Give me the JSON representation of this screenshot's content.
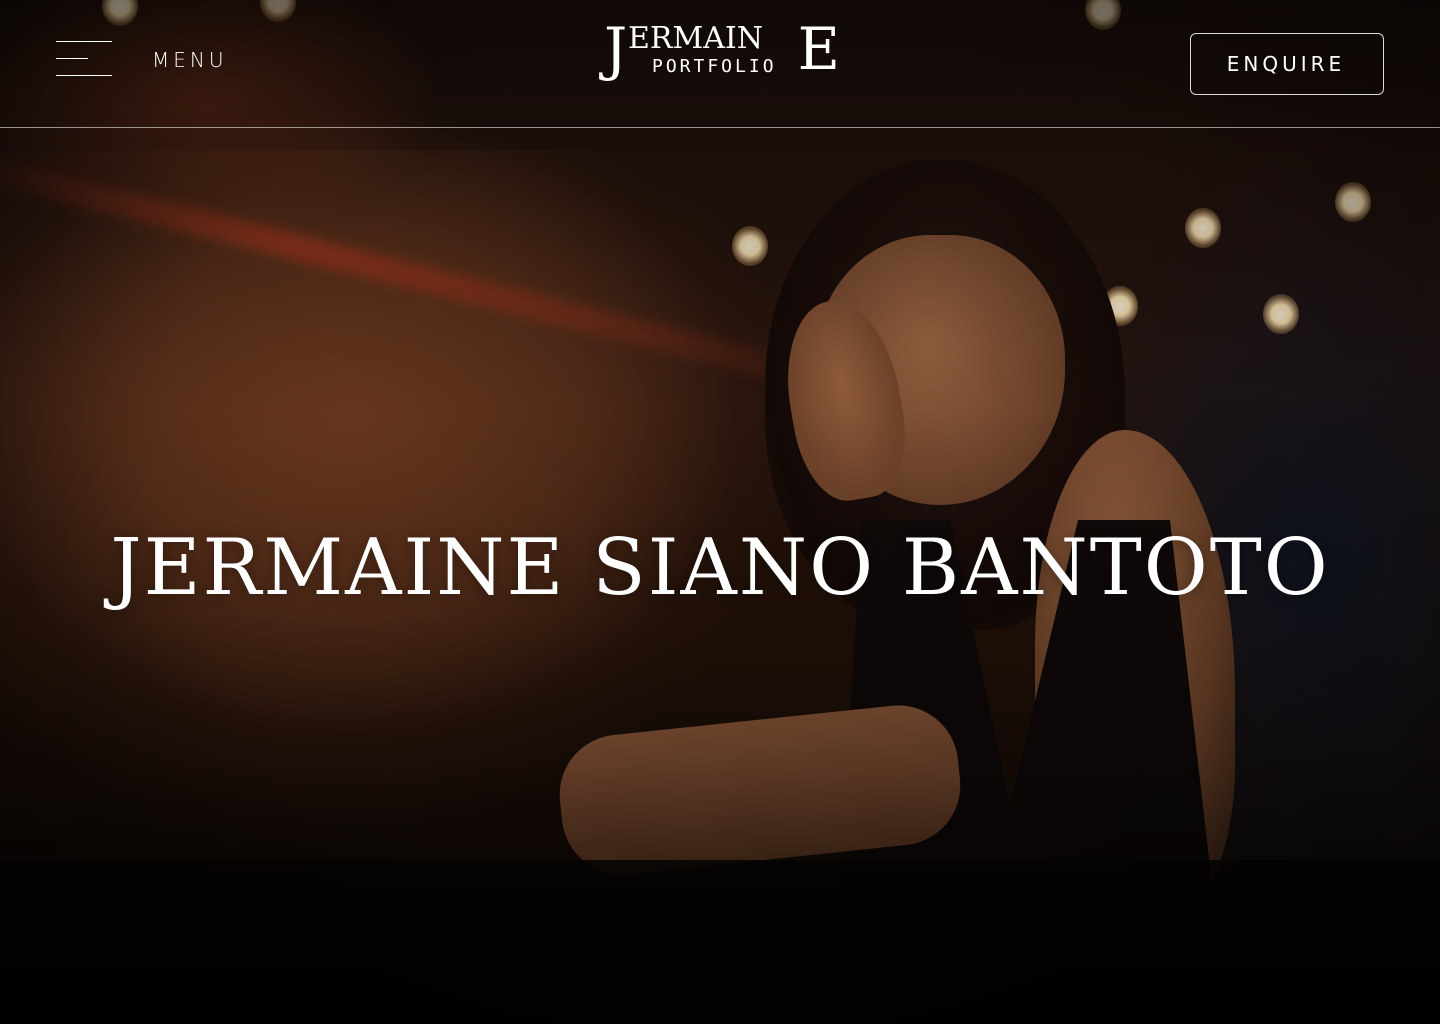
{
  "header": {
    "menu_label": "MENU",
    "logo": {
      "initial_left": "J",
      "middle": "ERMAIN",
      "initial_right": "E",
      "subtitle": "PORTFOLIO"
    },
    "enquire_label": "ENQUIRE"
  },
  "hero": {
    "title": "JERMAINE SIANO BANTOTO",
    "background_description": "portrait-photo",
    "colors": {
      "text": "#ffffff",
      "divider": "#ffffff",
      "background_dark": "#0c0807",
      "warm_accent": "#6a3a21"
    }
  }
}
